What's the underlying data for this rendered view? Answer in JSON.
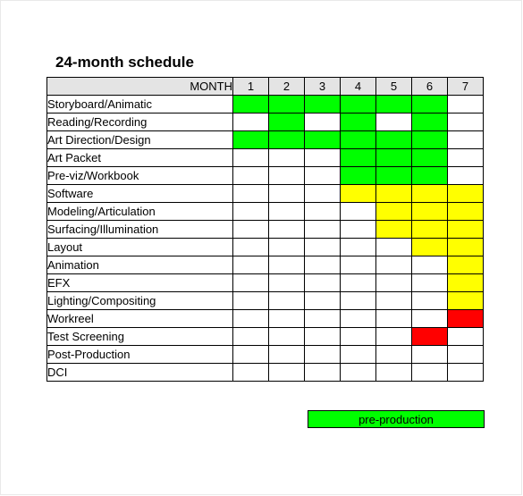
{
  "page": {
    "title": "24-month schedule"
  },
  "table": {
    "month_header": "MONTH",
    "columns": [
      "1",
      "2",
      "3",
      "4",
      "5",
      "6",
      "7"
    ],
    "rows": [
      {
        "label": "Storyboard/Animatic",
        "cells": [
          "g",
          "g",
          "g",
          "g",
          "g",
          "g",
          ""
        ]
      },
      {
        "label": "Reading/Recording",
        "cells": [
          "",
          "g",
          "",
          "g",
          "",
          "g",
          ""
        ]
      },
      {
        "label": "Art Direction/Design",
        "cells": [
          "g",
          "g",
          "g",
          "g",
          "g",
          "g",
          ""
        ]
      },
      {
        "label": "Art Packet",
        "cells": [
          "",
          "",
          "",
          "g",
          "g",
          "g",
          ""
        ]
      },
      {
        "label": "Pre-viz/Workbook",
        "cells": [
          "",
          "",
          "",
          "g",
          "g",
          "g",
          ""
        ]
      },
      {
        "label": "Software",
        "cells": [
          "",
          "",
          "",
          "y",
          "y",
          "y",
          "y"
        ]
      },
      {
        "label": "Modeling/Articulation",
        "cells": [
          "",
          "",
          "",
          "",
          "y",
          "y",
          "y"
        ]
      },
      {
        "label": "Surfacing/Illumination",
        "cells": [
          "",
          "",
          "",
          "",
          "y",
          "y",
          "y"
        ]
      },
      {
        "label": "Layout",
        "cells": [
          "",
          "",
          "",
          "",
          "",
          "y",
          "y"
        ]
      },
      {
        "label": "Animation",
        "cells": [
          "",
          "",
          "",
          "",
          "",
          "",
          "y"
        ]
      },
      {
        "label": "EFX",
        "cells": [
          "",
          "",
          "",
          "",
          "",
          "",
          "y"
        ]
      },
      {
        "label": "Lighting/Compositing",
        "cells": [
          "",
          "",
          "",
          "",
          "",
          "",
          "y"
        ]
      },
      {
        "label": "Workreel",
        "cells": [
          "",
          "",
          "",
          "",
          "",
          "",
          "r"
        ]
      },
      {
        "label": "Test Screening",
        "cells": [
          "",
          "",
          "",
          "",
          "",
          "r",
          ""
        ]
      },
      {
        "label": "Post-Production",
        "cells": [
          "",
          "",
          "",
          "",
          "",
          "",
          ""
        ]
      },
      {
        "label": "DCI",
        "cells": [
          "",
          "",
          "",
          "",
          "",
          "",
          ""
        ]
      }
    ]
  },
  "legend": {
    "label": "pre-production",
    "color": "#00ff00"
  },
  "colors": {
    "green": "#00ff00",
    "yellow": "#ffff00",
    "red": "#ff0000",
    "header_gray": "#e4e4e4",
    "grid_line": "#000000"
  }
}
